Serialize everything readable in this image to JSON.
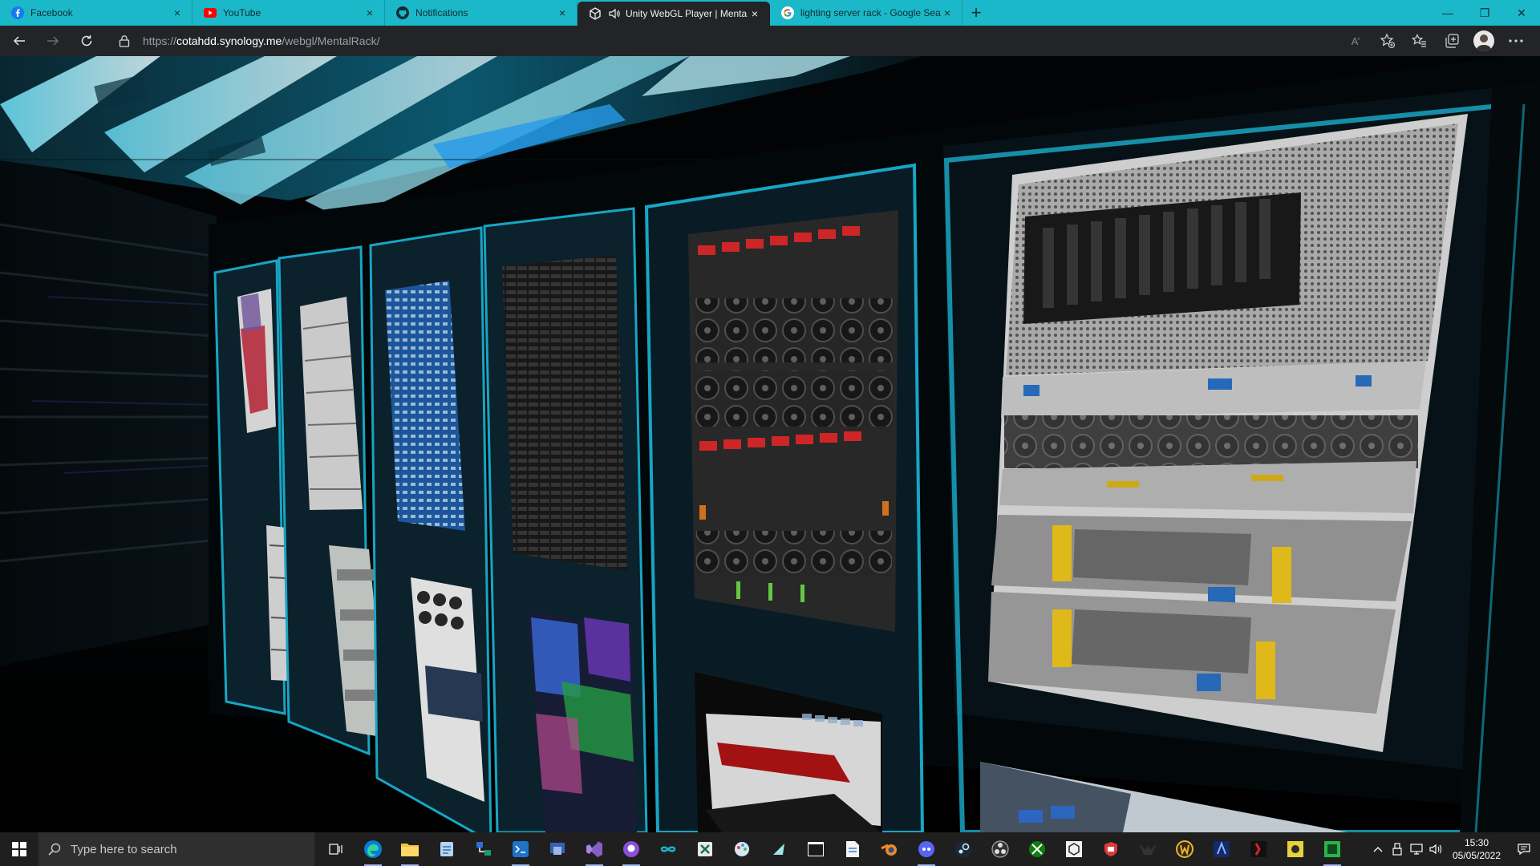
{
  "browser": {
    "tabs": [
      {
        "title": "Facebook",
        "icon": "facebook-icon",
        "active": false
      },
      {
        "title": "YouTube",
        "icon": "youtube-icon",
        "active": false
      },
      {
        "title": "Notifications",
        "icon": "github-icon",
        "active": false
      },
      {
        "title": "Unity WebGL Player | Menta",
        "icon": "unity-icon",
        "active": true,
        "audio": true
      },
      {
        "title": "lighting server rack - Google Sea",
        "icon": "google-icon",
        "active": false
      }
    ],
    "close_glyph": "×",
    "new_tab_glyph": "+",
    "window_controls": {
      "minimize": "—",
      "restore": "❐",
      "close": "✕"
    },
    "url": {
      "scheme": "https://",
      "host": "cotahdd.synology.me",
      "path": "/webgl/MentalRack/"
    },
    "read_aloud_label": "A’",
    "colors": {
      "tabstrip": "#1bb8c9",
      "toolbar": "#222428"
    }
  },
  "scene": {
    "description_free": true,
    "accent": "#1bb3d4"
  },
  "taskbar": {
    "search_placeholder": "Type here to search",
    "apps": [
      "task-view-icon",
      "edge-icon",
      "file-explorer-icon",
      "notepad-icon",
      "network-icon",
      "vscode-icon",
      "remote-icon",
      "visual-studio-icon",
      "github-desktop-icon",
      "infinity-icon",
      "excel-icon",
      "paint-icon",
      "app-icon",
      "terminal-icon",
      "document-icon",
      "blender-icon",
      "discord-icon",
      "steam-icon",
      "obs-icon",
      "xbox-icon",
      "unity-icon",
      "security-icon",
      "bird-icon",
      "warcraft-icon",
      "game-icon",
      "red-app-icon",
      "yellow-app-icon",
      "green-app-icon"
    ],
    "clock": {
      "time": "15:30",
      "date": "05/05/2022"
    }
  }
}
